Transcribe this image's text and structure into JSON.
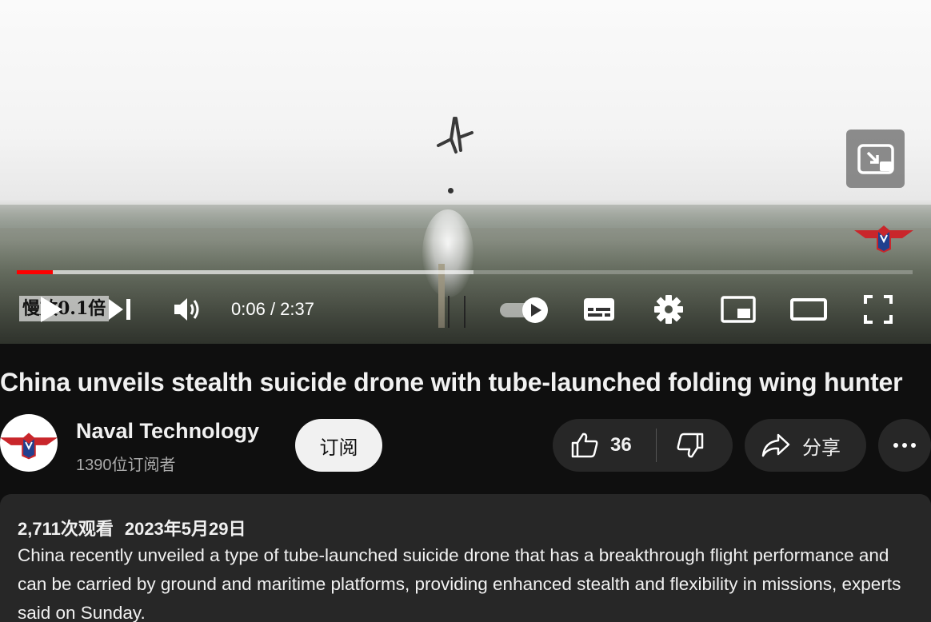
{
  "player": {
    "overlay_text": "慢放0.1倍",
    "current_time": "0:06",
    "time_separator": " / ",
    "duration": "2:37",
    "progress_played_fraction": 0.04,
    "progress_buffered_fraction": 0.51,
    "autoplay_on": true,
    "accent_color": "#ff0000",
    "icons": [
      "miniplayer-icon",
      "play-icon",
      "next-icon",
      "volume-icon",
      "autoplay-toggle-icon",
      "subtitles-icon",
      "settings-icon",
      "miniplayer-icon",
      "theater-mode-icon",
      "fullscreen-icon"
    ]
  },
  "video": {
    "title": "China unveils stealth suicide drone with tube-launched folding wing hunter"
  },
  "channel": {
    "name": "Naval Technology",
    "subscribers": "1390位订阅者",
    "subscribe_label": "订阅"
  },
  "actions": {
    "like_count": "36",
    "share_label": "分享"
  },
  "description": {
    "views": "2,711次观看",
    "date": "2023年5月29日",
    "text": "China recently unveiled a type of tube-launched suicide drone that has a breakthrough flight performance and can be carried by ground and maritime platforms, providing enhanced stealth and flexibility in missions, experts said on Sunday."
  }
}
